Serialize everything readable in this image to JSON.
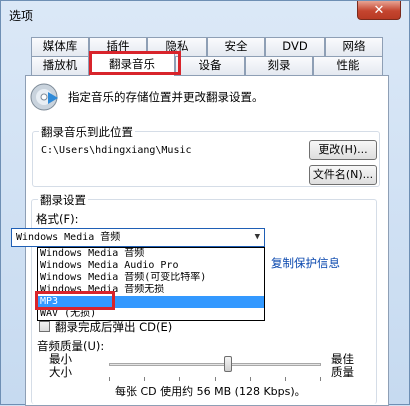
{
  "window": {
    "title": "选项"
  },
  "tabs": {
    "top_row": [
      "媒体库",
      "插件",
      "隐私",
      "安全",
      "DVD",
      "网络"
    ],
    "bottom_row": [
      "播放机",
      "翻录音乐",
      "设备",
      "刻录",
      "性能"
    ],
    "active": "翻录音乐"
  },
  "header": {
    "description": "指定音乐的存储位置并更改翻录设置。"
  },
  "rip_location": {
    "legend": "翻录音乐到此位置",
    "path": "C:\\Users\\hdingxiang\\Music",
    "change_button": "更改(H)...",
    "filename_button": "文件名(N)..."
  },
  "rip_settings": {
    "legend": "翻录设置",
    "format_label": "格式(F):",
    "selected_format": "Windows Media 音频",
    "options": [
      "Windows Media 音频",
      "Windows Media Audio Pro",
      "Windows Media 音频(可变比特率)",
      "Windows Media 音频无损",
      "MP3",
      "WAV (无损)"
    ],
    "highlighted_option": "MP3",
    "protection_link": "复制保护信息",
    "eject_label": "翻录完成后弹出 CD(E)",
    "quality_label": "音频质量(U):",
    "min_label": "最小\n大小",
    "max_label": "最佳\n质量",
    "quality_info": "每张 CD 使用约 56 MB (128 Kbps)。",
    "quality_level": 0.56
  },
  "colors": {
    "highlight_red": "#d8242b",
    "selection_blue": "#3399ff",
    "link_blue": "#0645ad"
  }
}
